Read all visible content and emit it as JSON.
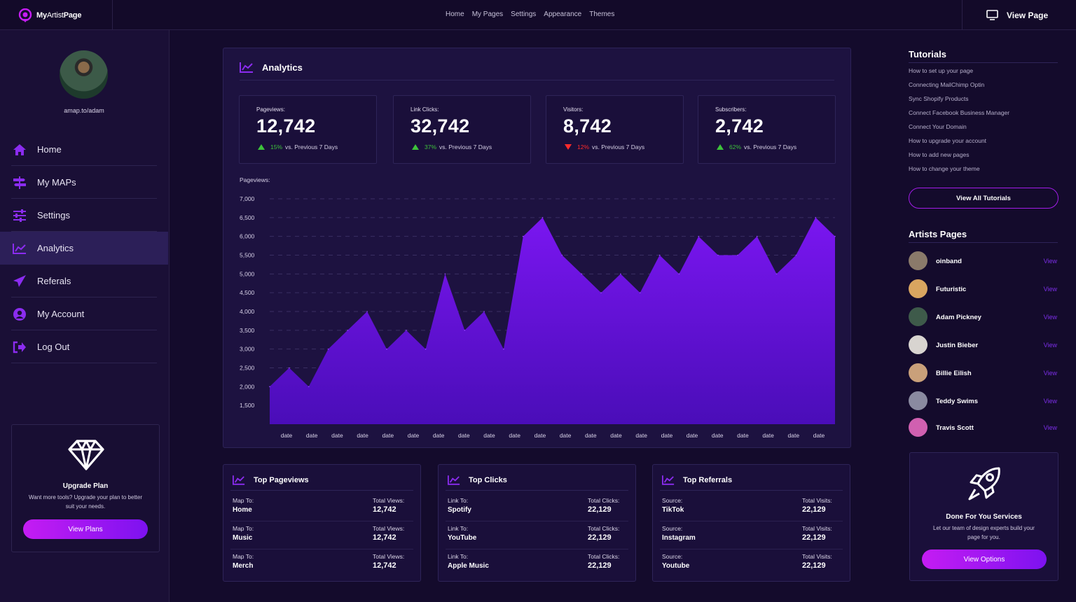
{
  "brand": {
    "name_bold_prefix": "My",
    "name_light": "Artist",
    "name_bold_suffix": "Page"
  },
  "topnav": [
    "Home",
    "My Pages",
    "Settings",
    "Appearance",
    "Themes"
  ],
  "view_page_label": "View Page",
  "profile": {
    "handle": "amap.to/adam"
  },
  "sidebar": {
    "items": [
      {
        "label": "Home",
        "icon": "home-icon"
      },
      {
        "label": "My MAPs",
        "icon": "signpost-icon"
      },
      {
        "label": "Settings",
        "icon": "sliders-icon"
      },
      {
        "label": "Analytics",
        "icon": "chart-line-icon",
        "active": true
      },
      {
        "label": "Referals",
        "icon": "paper-plane-icon"
      },
      {
        "label": "My Account",
        "icon": "user-circle-icon"
      },
      {
        "label": "Log Out",
        "icon": "sign-out-icon"
      }
    ]
  },
  "upgrade": {
    "title": "Upgrade Plan",
    "desc": "Want more tools? Upgrade your plan to better suit your needs.",
    "button": "View Plans"
  },
  "analytics": {
    "title": "Analytics",
    "stats": [
      {
        "label": "Pageviews:",
        "value": "12,742",
        "pct": "15%",
        "direction": "up",
        "suffix": "vs. Previous 7 Days"
      },
      {
        "label": "Link Clicks:",
        "value": "32,742",
        "pct": "37%",
        "direction": "up",
        "suffix": "vs. Previous 7 Days"
      },
      {
        "label": "Visitors:",
        "value": "8,742",
        "pct": "12%",
        "direction": "down",
        "suffix": "vs. Previous 7 Days"
      },
      {
        "label": "Subscribers:",
        "value": "2,742",
        "pct": "62%",
        "direction": "up",
        "suffix": "vs. Previous 7 Days"
      }
    ],
    "chart_label": "Pageviews:"
  },
  "chart_data": {
    "type": "area",
    "ylabel": "Pageviews:",
    "yticks": [
      1500,
      2000,
      2500,
      3000,
      3500,
      4000,
      4500,
      5000,
      5500,
      6000,
      6500,
      7000
    ],
    "ylim": [
      1000,
      7000
    ],
    "x": [
      "date",
      "date",
      "date",
      "date",
      "date",
      "date",
      "date",
      "date",
      "date",
      "date",
      "date",
      "date",
      "date",
      "date",
      "date",
      "date",
      "date",
      "date",
      "date",
      "date",
      "date",
      "date"
    ],
    "values": [
      2000,
      2500,
      2000,
      3000,
      3500,
      4000,
      3000,
      3500,
      3000,
      5000,
      3500,
      4000,
      3000,
      6000,
      6500,
      5500,
      5000,
      4500,
      5000,
      4500,
      5500,
      5000,
      6000,
      5500,
      5500,
      6000,
      5000,
      5500,
      6500,
      6000
    ],
    "grid": true,
    "color": "#6a0fe0"
  },
  "bottom_cards": [
    {
      "title": "Top Pageviews",
      "rows": [
        {
          "k1": "Map To:",
          "v1": "Home",
          "k2": "Total Views:",
          "v2": "12,742"
        },
        {
          "k1": "Map To:",
          "v1": "Music",
          "k2": "Total Views:",
          "v2": "12,742"
        },
        {
          "k1": "Map To:",
          "v1": "Merch",
          "k2": "Total Views:",
          "v2": "12,742"
        }
      ]
    },
    {
      "title": "Top Clicks",
      "rows": [
        {
          "k1": "Link To:",
          "v1": "Spotify",
          "k2": "Total Clicks:",
          "v2": "22,129"
        },
        {
          "k1": "Link To:",
          "v1": "YouTube",
          "k2": "Total Clicks:",
          "v2": "22,129"
        },
        {
          "k1": "Link To:",
          "v1": "Apple Music",
          "k2": "Total Clicks:",
          "v2": "22,129"
        }
      ]
    },
    {
      "title": "Top Referrals",
      "rows": [
        {
          "k1": "Source:",
          "v1": "TikTok",
          "k2": "Total Visits:",
          "v2": "22,129"
        },
        {
          "k1": "Source:",
          "v1": "Instagram",
          "k2": "Total Visits:",
          "v2": "22,129"
        },
        {
          "k1": "Source:",
          "v1": "Youtube",
          "k2": "Total Visits:",
          "v2": "22,129"
        }
      ]
    }
  ],
  "tutorials": {
    "title": "Tutorials",
    "items": [
      "How to set up your page",
      "Connecting MailChimp Optin",
      "Sync Shopify Products",
      "Connect Facebook Business Manager",
      "Connect Your Domain",
      "How to upgrade your account",
      "How to add new pages",
      "How to change your theme"
    ],
    "button": "View All Tutorials"
  },
  "artists": {
    "title": "Artists Pages",
    "view_label": "View",
    "items": [
      {
        "name": "oinband",
        "color": "#8a7a6a"
      },
      {
        "name": "Futuristic",
        "color": "#d9a560"
      },
      {
        "name": "Adam Pickney",
        "color": "#3e5a4a"
      },
      {
        "name": "Justin Bieber",
        "color": "#d8d4d0"
      },
      {
        "name": "Billie Eilish",
        "color": "#c9a07a"
      },
      {
        "name": "Teddy Swims",
        "color": "#8a8aa0"
      },
      {
        "name": "Travis Scott",
        "color": "#d060b0"
      }
    ]
  },
  "dfy": {
    "title": "Done For You Services",
    "desc": "Let our team of design experts build your page for you.",
    "button": "View Options"
  },
  "colors": {
    "accent": "#7d12f0",
    "accent2": "#c51cf3",
    "bg": "#140b2c",
    "panel": "#1d1240"
  }
}
